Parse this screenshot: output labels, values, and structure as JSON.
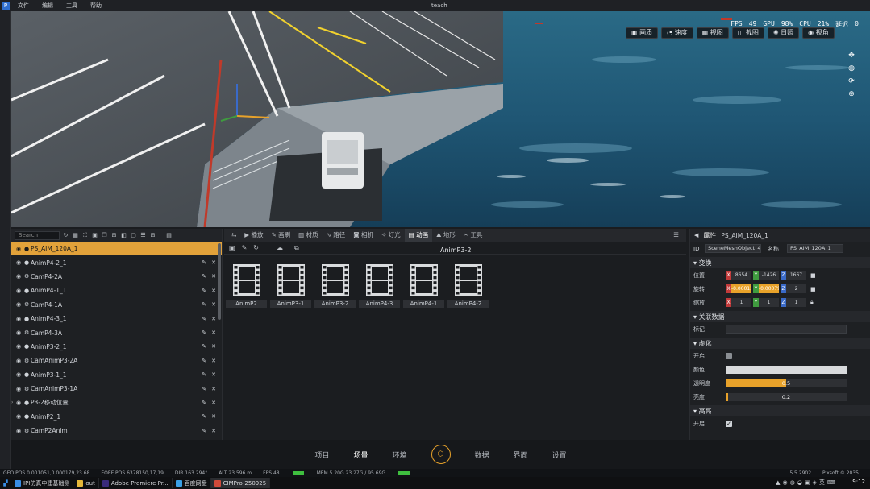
{
  "menu": [
    "文件",
    "编辑",
    "工具",
    "帮助"
  ],
  "window_title": "teach",
  "stats": {
    "fps_label": "FPS",
    "fps": "49",
    "gpu_label": "GPU",
    "gpu": "98%",
    "cpu_label": "CPU",
    "cpu": "21%",
    "delay_label": "延迟",
    "delay": "0"
  },
  "viewport_toolbar": [
    "画质",
    "速度",
    "视图",
    "截图",
    "日照",
    "视角"
  ],
  "scene": {
    "search_placeholder": "Search",
    "items": [
      {
        "name": "PS_AIM_120A_1",
        "selected": true
      },
      {
        "name": "AnimP4-2_1"
      },
      {
        "name": "CamP4-2A"
      },
      {
        "name": "AnimP4-1_1"
      },
      {
        "name": "CamP4-1A"
      },
      {
        "name": "AnimP4-3_1"
      },
      {
        "name": "CamP4-3A"
      },
      {
        "name": "AnimP3-2_1"
      },
      {
        "name": "CamAnimP3-2A"
      },
      {
        "name": "AnimP3-1_1"
      },
      {
        "name": "CamAnimP3-1A"
      },
      {
        "name": "P3-2移动位置"
      },
      {
        "name": "AnimP2_1"
      },
      {
        "name": "CamP2Anim"
      }
    ]
  },
  "assets": {
    "tabs": [
      "播放",
      "画刷",
      "材质",
      "路径",
      "相机",
      "灯光",
      "动画",
      "地形",
      "工具"
    ],
    "active_tab": "动画",
    "path": "AnimP3-2",
    "tiles": [
      "AnimP2",
      "AnimP3-1",
      "AnimP3-2",
      "AnimP4-3",
      "AnimP4-1",
      "AnimP4-2"
    ]
  },
  "props": {
    "title": "属性",
    "object": "PS_AIM_120A_1",
    "id_label": "ID",
    "id_value": "SceneMeshObject_45",
    "name_label": "名称",
    "name_value": "PS_AIM_120A_1",
    "sec_transform": "变换",
    "pos_label": "位置",
    "pos": [
      "8654",
      "-1426",
      "1667"
    ],
    "rot_label": "旋转",
    "rot": [
      "-0.00013",
      "-0.00079",
      "2"
    ],
    "scale_label": "缩放",
    "scale": [
      "1",
      "1",
      "1"
    ],
    "sec_assoc": "关联数据",
    "tag_label": "标记",
    "sec_blur": "虚化",
    "enable_label": "开启",
    "color_label": "颜色",
    "opacity_label": "透明度",
    "opacity_value": "0.5",
    "opacity_fraction": 0.5,
    "bright_label": "亮度",
    "bright_value": "0.2",
    "bright_fraction": 0.02,
    "sec_highlight": "高亮",
    "enable2_label": "开启"
  },
  "bottom_nav": [
    "项目",
    "场景",
    "环境",
    "数据",
    "界面",
    "设置"
  ],
  "bottom_nav_active": "场景",
  "status": {
    "geo": "GEO POS  0.001051,0.000179,23.68",
    "eoef": "EOEF POS  6378150,17,19",
    "dir": "DIR  163.294°",
    "alt": "ALT  23.596 m",
    "fps": "FPS  48",
    "mem": "MEM  5.20G  23.27G / 95.69G",
    "ver": "5.5.2902",
    "copy": "Pixsoft © 2035"
  },
  "taskbar": {
    "items": [
      "IPI仿真中建基础测",
      "out",
      "Adobe Premiere Pr...",
      "百度网盘",
      "CIMPro-250925"
    ],
    "active": "CIMPro-250925",
    "ime": "英",
    "clock": "9:12"
  },
  "colors": {
    "accent": "#e8a22a",
    "x": "#c23a3a",
    "y": "#3f9b3f",
    "z": "#3a6ac8"
  }
}
